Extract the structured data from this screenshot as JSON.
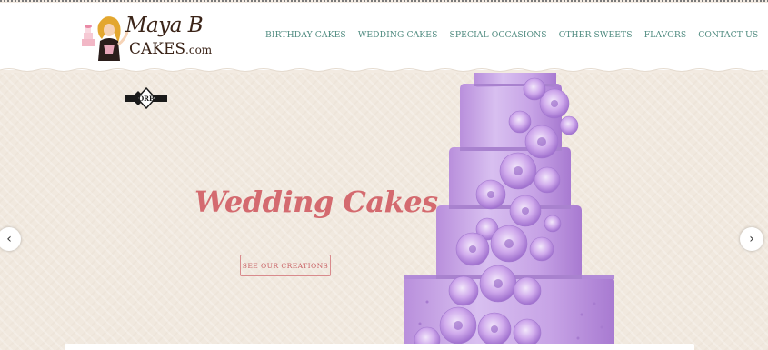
{
  "brand": {
    "logo_script": "Maya B",
    "logo_sub": "CAKES",
    "logo_suffix": ".com"
  },
  "nav": {
    "items": [
      {
        "label": "BIRTHDAY CAKES"
      },
      {
        "label": "WEDDING CAKES"
      },
      {
        "label": "SPECIAL OCCASIONS"
      },
      {
        "label": "OTHER SWEETS"
      },
      {
        "label": "FLAVORS"
      },
      {
        "label": "CONTACT US"
      }
    ]
  },
  "hero": {
    "badge_text": "ORB",
    "title": "Wedding Cakes",
    "cta_label": "SEE OUR CREATIONS",
    "prev_icon": "‹",
    "next_icon": "›"
  },
  "colors": {
    "nav_link": "#4e8a7f",
    "hero_title": "#d46a6f",
    "cta": "#c85f63",
    "cake": "#c9a6e8"
  }
}
